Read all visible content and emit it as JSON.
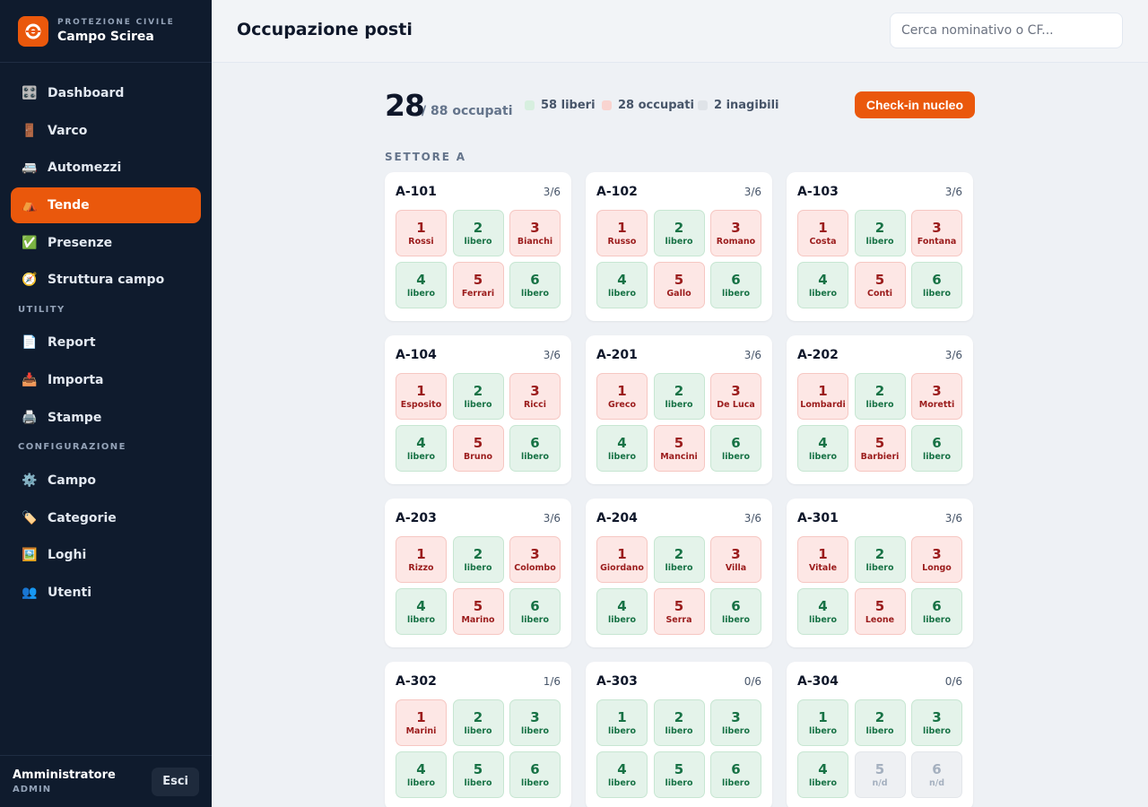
{
  "brand": {
    "kicker": "PROTEZIONE CIVILE",
    "name": "Campo Scirea",
    "logo_icon": "lifebuoy-icon"
  },
  "nav": {
    "main": [
      {
        "icon": "🎛️",
        "icon_name": "control-knobs-icon",
        "label": "Dashboard",
        "active": false
      },
      {
        "icon": "🚪",
        "icon_name": "door-icon",
        "label": "Varco",
        "active": false
      },
      {
        "icon": "🚐",
        "icon_name": "minibus-icon",
        "label": "Automezzi",
        "active": false
      },
      {
        "icon": "⛺",
        "icon_name": "tent-icon",
        "label": "Tende",
        "active": true
      },
      {
        "icon": "✅",
        "icon_name": "check-icon",
        "label": "Presenze",
        "active": false
      },
      {
        "icon": "🧭",
        "icon_name": "compass-icon",
        "label": "Struttura campo",
        "active": false
      }
    ],
    "utility_title": "UTILITY",
    "utility": [
      {
        "icon": "📄",
        "icon_name": "document-icon",
        "label": "Report"
      },
      {
        "icon": "📥",
        "icon_name": "inbox-icon",
        "label": "Importa"
      },
      {
        "icon": "🖨️",
        "icon_name": "printer-icon",
        "label": "Stampe"
      }
    ],
    "config_title": "CONFIGURAZIONE",
    "config": [
      {
        "icon": "⚙️",
        "icon_name": "gear-icon",
        "label": "Campo"
      },
      {
        "icon": "🏷️",
        "icon_name": "tag-icon",
        "label": "Categorie"
      },
      {
        "icon": "🖼️",
        "icon_name": "picture-icon",
        "label": "Loghi"
      },
      {
        "icon": "👥",
        "icon_name": "users-icon",
        "label": "Utenti"
      }
    ]
  },
  "user": {
    "name": "Amministratore",
    "role": "ADMIN",
    "logout_label": "Esci"
  },
  "header": {
    "title": "Occupazione posti",
    "search_placeholder": "Cerca nominativo o CF..."
  },
  "summary": {
    "occupied": "28",
    "total_text": "/ 88 occupati",
    "legend_free": "58 liberi",
    "legend_occupied": "28 occupati",
    "legend_unusable": "2 inagibili",
    "checkin_label": "Check-in nucleo"
  },
  "colors": {
    "accent": "#ea580c",
    "sidebar": "#0f1b2d",
    "free": "#177245",
    "occupied": "#9b1c1c"
  },
  "sector": {
    "title": "SETTORE A",
    "tents": [
      {
        "name": "A-101",
        "count": "3/6",
        "beds": [
          {
            "n": "1",
            "label": "Rossi",
            "status": "occ"
          },
          {
            "n": "2",
            "label": "libero",
            "status": "free"
          },
          {
            "n": "3",
            "label": "Bianchi",
            "status": "occ"
          },
          {
            "n": "4",
            "label": "libero",
            "status": "free"
          },
          {
            "n": "5",
            "label": "Ferrari",
            "status": "occ"
          },
          {
            "n": "6",
            "label": "libero",
            "status": "free"
          }
        ]
      },
      {
        "name": "A-102",
        "count": "3/6",
        "beds": [
          {
            "n": "1",
            "label": "Russo",
            "status": "occ"
          },
          {
            "n": "2",
            "label": "libero",
            "status": "free"
          },
          {
            "n": "3",
            "label": "Romano",
            "status": "occ"
          },
          {
            "n": "4",
            "label": "libero",
            "status": "free"
          },
          {
            "n": "5",
            "label": "Gallo",
            "status": "occ"
          },
          {
            "n": "6",
            "label": "libero",
            "status": "free"
          }
        ]
      },
      {
        "name": "A-103",
        "count": "3/6",
        "beds": [
          {
            "n": "1",
            "label": "Costa",
            "status": "occ"
          },
          {
            "n": "2",
            "label": "libero",
            "status": "free"
          },
          {
            "n": "3",
            "label": "Fontana",
            "status": "occ"
          },
          {
            "n": "4",
            "label": "libero",
            "status": "free"
          },
          {
            "n": "5",
            "label": "Conti",
            "status": "occ"
          },
          {
            "n": "6",
            "label": "libero",
            "status": "free"
          }
        ]
      },
      {
        "name": "A-104",
        "count": "3/6",
        "beds": [
          {
            "n": "1",
            "label": "Esposito",
            "status": "occ"
          },
          {
            "n": "2",
            "label": "libero",
            "status": "free"
          },
          {
            "n": "3",
            "label": "Ricci",
            "status": "occ"
          },
          {
            "n": "4",
            "label": "libero",
            "status": "free"
          },
          {
            "n": "5",
            "label": "Bruno",
            "status": "occ"
          },
          {
            "n": "6",
            "label": "libero",
            "status": "free"
          }
        ]
      },
      {
        "name": "A-201",
        "count": "3/6",
        "beds": [
          {
            "n": "1",
            "label": "Greco",
            "status": "occ"
          },
          {
            "n": "2",
            "label": "libero",
            "status": "free"
          },
          {
            "n": "3",
            "label": "De Luca",
            "status": "occ"
          },
          {
            "n": "4",
            "label": "libero",
            "status": "free"
          },
          {
            "n": "5",
            "label": "Mancini",
            "status": "occ"
          },
          {
            "n": "6",
            "label": "libero",
            "status": "free"
          }
        ]
      },
      {
        "name": "A-202",
        "count": "3/6",
        "beds": [
          {
            "n": "1",
            "label": "Lombardi",
            "status": "occ"
          },
          {
            "n": "2",
            "label": "libero",
            "status": "free"
          },
          {
            "n": "3",
            "label": "Moretti",
            "status": "occ"
          },
          {
            "n": "4",
            "label": "libero",
            "status": "free"
          },
          {
            "n": "5",
            "label": "Barbieri",
            "status": "occ"
          },
          {
            "n": "6",
            "label": "libero",
            "status": "free"
          }
        ]
      },
      {
        "name": "A-203",
        "count": "3/6",
        "beds": [
          {
            "n": "1",
            "label": "Rizzo",
            "status": "occ"
          },
          {
            "n": "2",
            "label": "libero",
            "status": "free"
          },
          {
            "n": "3",
            "label": "Colombo",
            "status": "occ"
          },
          {
            "n": "4",
            "label": "libero",
            "status": "free"
          },
          {
            "n": "5",
            "label": "Marino",
            "status": "occ"
          },
          {
            "n": "6",
            "label": "libero",
            "status": "free"
          }
        ]
      },
      {
        "name": "A-204",
        "count": "3/6",
        "beds": [
          {
            "n": "1",
            "label": "Giordano",
            "status": "occ"
          },
          {
            "n": "2",
            "label": "libero",
            "status": "free"
          },
          {
            "n": "3",
            "label": "Villa",
            "status": "occ"
          },
          {
            "n": "4",
            "label": "libero",
            "status": "free"
          },
          {
            "n": "5",
            "label": "Serra",
            "status": "occ"
          },
          {
            "n": "6",
            "label": "libero",
            "status": "free"
          }
        ]
      },
      {
        "name": "A-301",
        "count": "3/6",
        "beds": [
          {
            "n": "1",
            "label": "Vitale",
            "status": "occ"
          },
          {
            "n": "2",
            "label": "libero",
            "status": "free"
          },
          {
            "n": "3",
            "label": "Longo",
            "status": "occ"
          },
          {
            "n": "4",
            "label": "libero",
            "status": "free"
          },
          {
            "n": "5",
            "label": "Leone",
            "status": "occ"
          },
          {
            "n": "6",
            "label": "libero",
            "status": "free"
          }
        ]
      },
      {
        "name": "A-302",
        "count": "1/6",
        "beds": [
          {
            "n": "1",
            "label": "Marini",
            "status": "occ"
          },
          {
            "n": "2",
            "label": "libero",
            "status": "free"
          },
          {
            "n": "3",
            "label": "libero",
            "status": "free"
          },
          {
            "n": "4",
            "label": "libero",
            "status": "free"
          },
          {
            "n": "5",
            "label": "libero",
            "status": "free"
          },
          {
            "n": "6",
            "label": "libero",
            "status": "free"
          }
        ]
      },
      {
        "name": "A-303",
        "count": "0/6",
        "beds": [
          {
            "n": "1",
            "label": "libero",
            "status": "free"
          },
          {
            "n": "2",
            "label": "libero",
            "status": "free"
          },
          {
            "n": "3",
            "label": "libero",
            "status": "free"
          },
          {
            "n": "4",
            "label": "libero",
            "status": "free"
          },
          {
            "n": "5",
            "label": "libero",
            "status": "free"
          },
          {
            "n": "6",
            "label": "libero",
            "status": "free"
          }
        ]
      },
      {
        "name": "A-304",
        "count": "0/6",
        "beds": [
          {
            "n": "1",
            "label": "libero",
            "status": "free"
          },
          {
            "n": "2",
            "label": "libero",
            "status": "free"
          },
          {
            "n": "3",
            "label": "libero",
            "status": "free"
          },
          {
            "n": "4",
            "label": "libero",
            "status": "free"
          },
          {
            "n": "5",
            "label": "n/d",
            "status": "na"
          },
          {
            "n": "6",
            "label": "n/d",
            "status": "na"
          }
        ]
      }
    ]
  }
}
